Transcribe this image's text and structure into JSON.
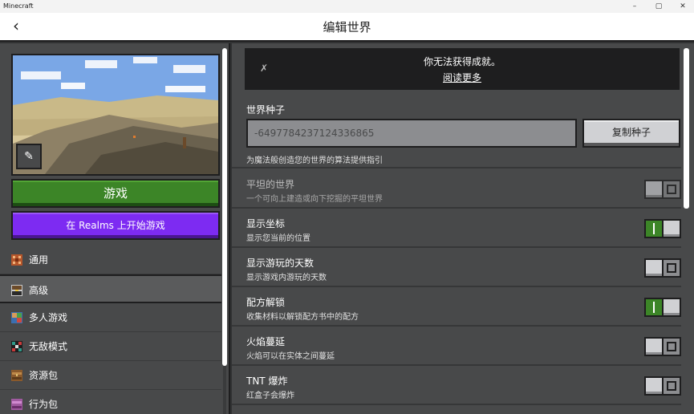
{
  "window": {
    "app_name": "Minecraft",
    "minimize": "–",
    "maximize": "▢",
    "close": "✕"
  },
  "header": {
    "back": "‹",
    "title": "编辑世界"
  },
  "left": {
    "play_label": "游戏",
    "realms_label": "在 Realms 上开始游戏",
    "nav": [
      {
        "label": "通用",
        "icon": "general-icon"
      },
      {
        "label": "高级",
        "icon": "advanced-icon"
      },
      {
        "label": "多人游戏",
        "icon": "multiplayer-icon"
      },
      {
        "label": "无敌模式",
        "icon": "cheats-icon"
      },
      {
        "label": "资源包",
        "icon": "resource-pack-icon"
      },
      {
        "label": "行为包",
        "icon": "behavior-pack-icon"
      }
    ]
  },
  "achievement": {
    "text": "你无法获得成就。",
    "link": "阅读更多"
  },
  "seed": {
    "title": "世界种子",
    "value": "-6497784237124336865",
    "copy_label": "复制种子",
    "hint": "为魔法般创造您的世界的算法提供指引"
  },
  "settings": [
    {
      "title": "平坦的世界",
      "desc": "一个可向上建造或向下挖掘的平坦世界",
      "on": false,
      "disabled": true
    },
    {
      "title": "显示坐标",
      "desc": "显示您当前的位置",
      "on": true,
      "disabled": false
    },
    {
      "title": "显示游玩的天数",
      "desc": "显示游戏内游玩的天数",
      "on": false,
      "disabled": false
    },
    {
      "title": "配方解锁",
      "desc": "收集材料以解锁配方书中的配方",
      "on": true,
      "disabled": false
    },
    {
      "title": "火焰蔓延",
      "desc": "火焰可以在实体之间蔓延",
      "on": false,
      "disabled": false
    },
    {
      "title": "TNT 爆炸",
      "desc": "红盒子会爆炸",
      "on": false,
      "disabled": false
    }
  ]
}
